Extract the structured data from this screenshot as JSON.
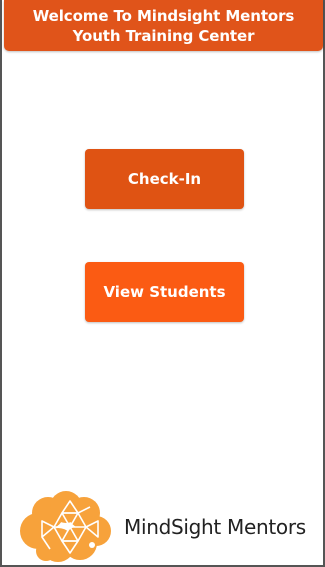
{
  "header": {
    "title": "Welcome To Mindsight Mentors Youth Training Center"
  },
  "actions": {
    "checkin_label": "Check-In",
    "view_students_label": "View Students"
  },
  "branding": {
    "logo_text": "MindSight Mentors",
    "logo_icon": "brain-icon"
  },
  "colors": {
    "header_bg": "#e0541a",
    "checkin_bg": "#df5313",
    "view_students_bg": "#fb5b13",
    "logo_orange": "#f7a23b"
  }
}
